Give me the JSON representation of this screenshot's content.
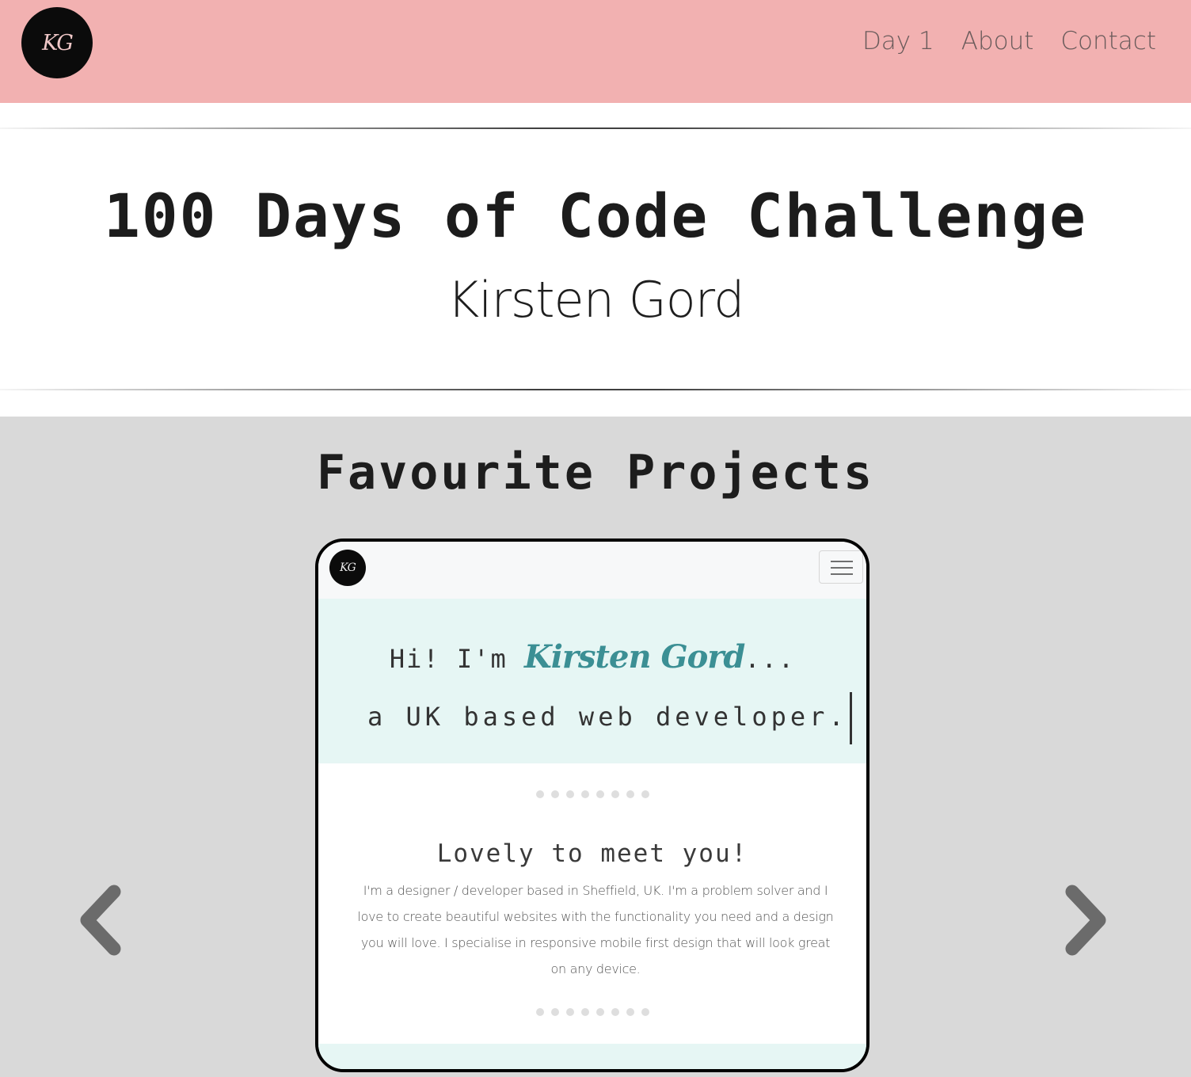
{
  "nav": {
    "logo_text": "KG",
    "links": [
      "Day 1",
      "About",
      "Contact"
    ]
  },
  "hero": {
    "title": "100 Days of Code Challenge",
    "subtitle": "Kirsten Gord"
  },
  "projects": {
    "title": "Favourite Projects",
    "carousel": {
      "prev_icon": "chevron-left-icon",
      "next_icon": "chevron-right-icon",
      "slide": {
        "logo_text": "KG",
        "menu_icon": "hamburger-menu-icon",
        "greeting_prefix": "Hi! I'm ",
        "greeting_name": "Kirsten Gord",
        "greeting_suffix": "...",
        "role": "a UK based web developer.",
        "heading": "Lovely to meet you!",
        "paragraph": "I'm a designer / developer based in Sheffield, UK. I'm a problem solver and I love to create beautiful websites with the functionality you need and a design you will love. I specialise in responsive mobile first design that will look great on any device."
      }
    }
  },
  "colors": {
    "navbar": "#f2b1b1",
    "projects_bg": "#d9d9d9",
    "slide_banner": "#e6f6f4",
    "accent_name": "#3b8f94"
  }
}
